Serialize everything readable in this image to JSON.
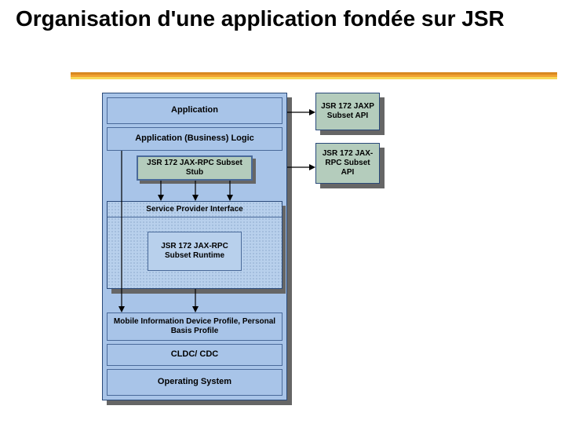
{
  "title": "Organisation d'une application fondée sur JSR",
  "stack": {
    "application": "Application",
    "business_logic": "Application (Business) Logic",
    "jaxrpc_stub": "JSR 172 JAX-RPC Subset Stub",
    "spi": "Service Provider Interface",
    "runtime": "JSR 172 JAX-RPC Subset Runtime",
    "profile": "Mobile Information Device Profile, Personal Basis Profile",
    "cldc": "CLDC/ CDC",
    "os": "Operating System"
  },
  "side": {
    "jaxp": "JSR 172 JAXP Subset API",
    "jaxrpc_api": "JSR 172 JAX-RPC Subset API"
  },
  "colors": {
    "box_blue": "#a8c4e8",
    "box_teal": "#b4ccbc",
    "border": "#2a4a7a",
    "shadow": "#666666",
    "underline_orange": "#f0a030",
    "underline_yellow": "#f8d858"
  }
}
